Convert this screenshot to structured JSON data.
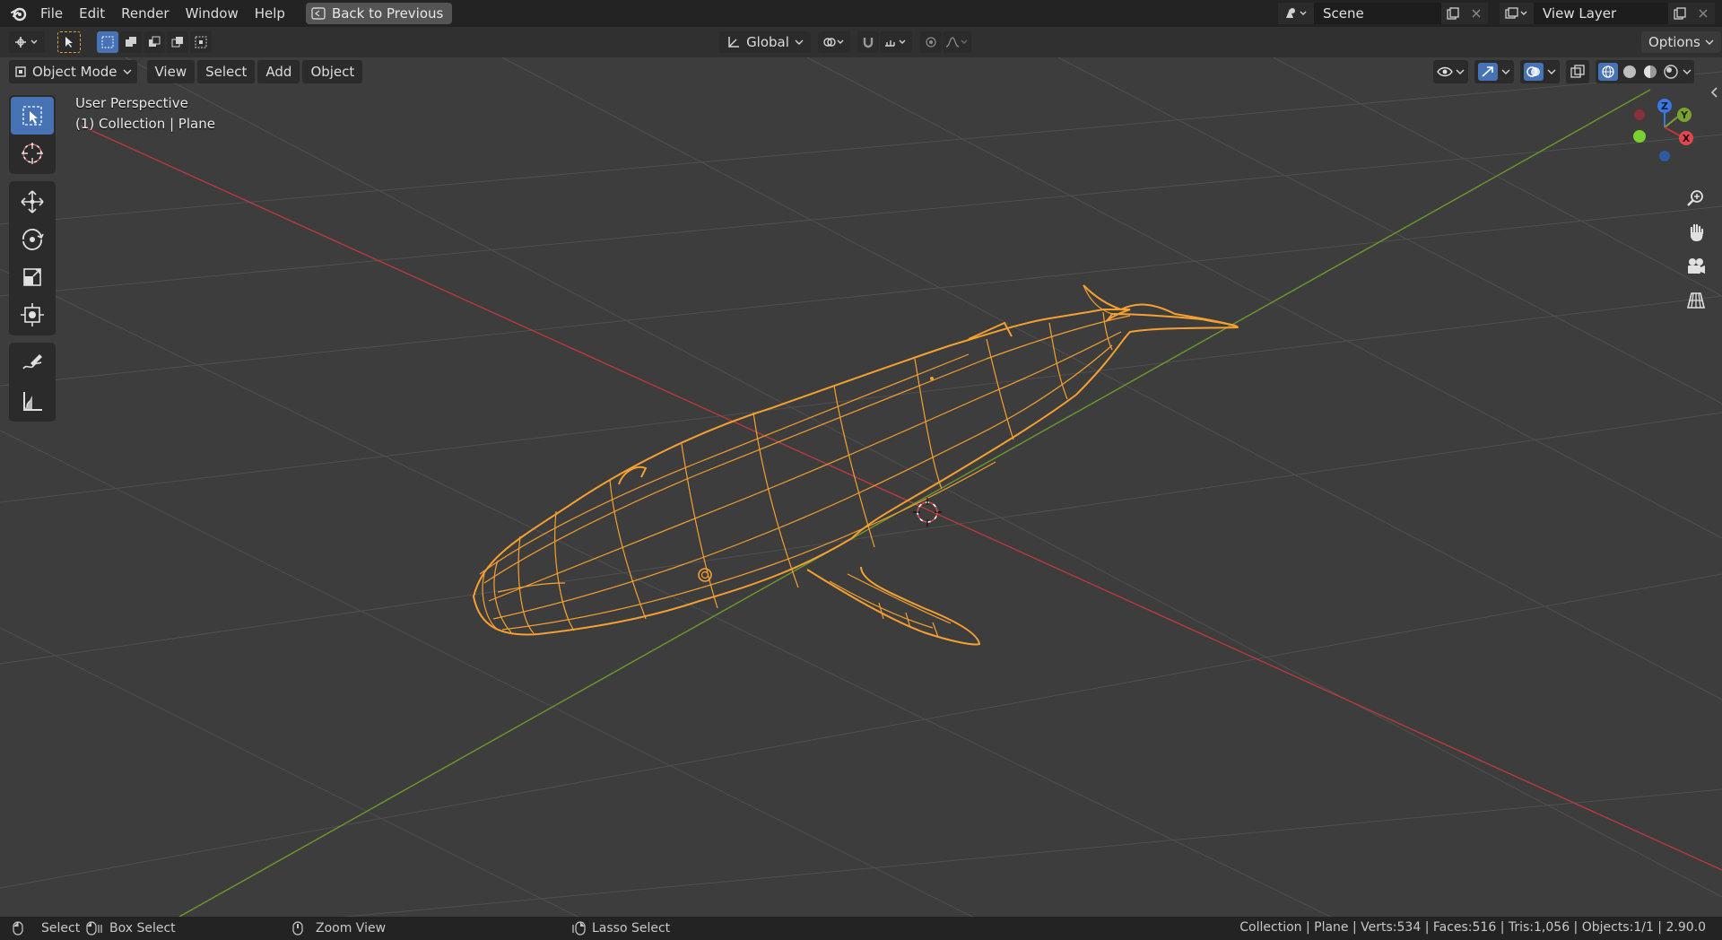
{
  "menu": {
    "items": [
      "File",
      "Edit",
      "Render",
      "Window",
      "Help"
    ],
    "back_button": "Back to Previous"
  },
  "scene": {
    "label": "Scene"
  },
  "view_layer": {
    "label": "View Layer"
  },
  "header": {
    "transform_orientation": "Global",
    "options": "Options"
  },
  "viewport": {
    "mode": "Object Mode",
    "menus": [
      "View",
      "Select",
      "Add",
      "Object"
    ],
    "perspective_label": "User Perspective",
    "collection_label": "(1) Collection | Plane",
    "gizmo_axes": {
      "z": "Z",
      "y": "Y",
      "x": "X"
    }
  },
  "statusbar": {
    "select": "Select",
    "box_select": "Box Select",
    "zoom_view": "Zoom View",
    "lasso_select": "Lasso Select",
    "stats": "Collection | Plane | Verts:534 | Faces:516 | Tris:1,056 | Objects:1/1 | 2.90.0"
  },
  "colors": {
    "selection_orange": "#f5a030",
    "x_axis": "#c0353a",
    "y_axis": "#7aa230",
    "z_axis": "#3a78e0",
    "active_tool": "#4772b3"
  }
}
